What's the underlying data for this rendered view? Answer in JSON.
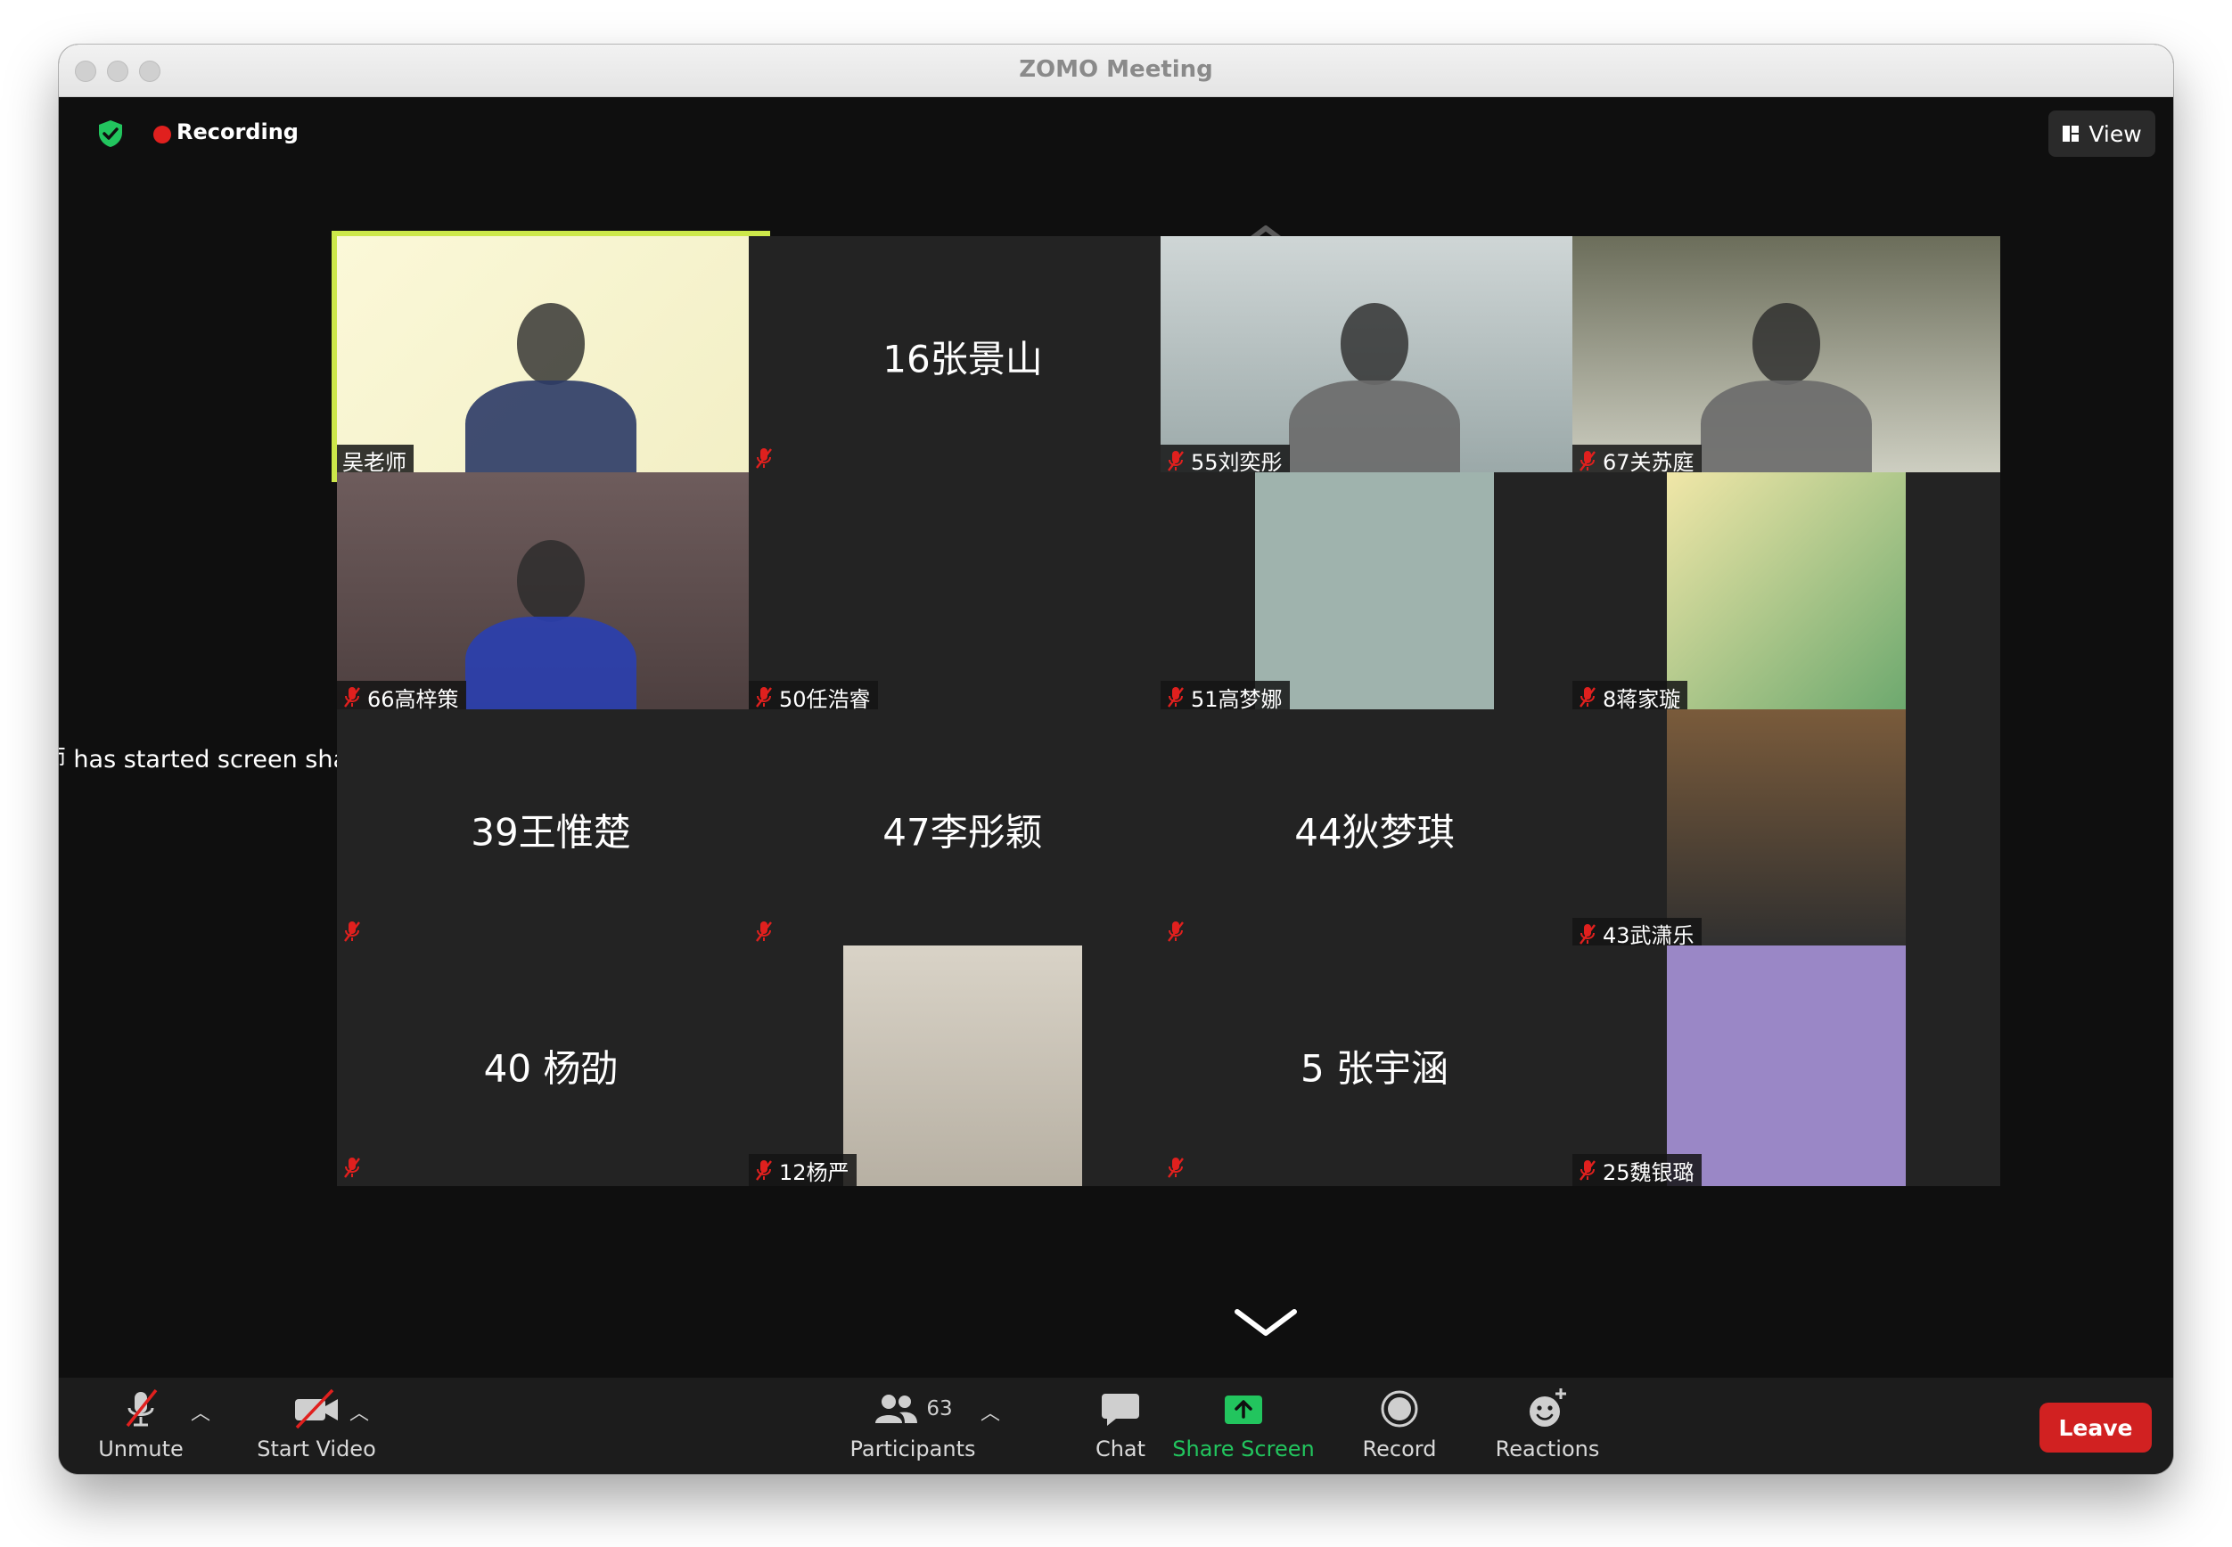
{
  "window": {
    "title": "ZOMO Meeting"
  },
  "topbar": {
    "recording_label": "Recording",
    "view_label": "View"
  },
  "share_notice": "师 has started screen sha",
  "tiles": [
    {
      "name": "吴老师",
      "display": "",
      "kind": "video",
      "active": true
    },
    {
      "name": "",
      "display": "16张景山",
      "kind": "text"
    },
    {
      "name": "55刘奕彤",
      "display": "",
      "kind": "video"
    },
    {
      "name": "67关苏庭",
      "display": "",
      "kind": "video"
    },
    {
      "name": "66高梓策",
      "display": "",
      "kind": "video"
    },
    {
      "name": "50任浩睿",
      "display": "",
      "kind": "blank"
    },
    {
      "name": "51高梦娜",
      "display": "",
      "kind": "avatar"
    },
    {
      "name": "8蒋家璇",
      "display": "",
      "kind": "avatar"
    },
    {
      "name": "",
      "display": "39王惟楚",
      "kind": "text"
    },
    {
      "name": "",
      "display": "47李彤颖",
      "kind": "text"
    },
    {
      "name": "",
      "display": "44狄梦琪",
      "kind": "text"
    },
    {
      "name": "43武潇乐",
      "display": "",
      "kind": "avatar"
    },
    {
      "name": "",
      "display": "40 杨劭",
      "kind": "text"
    },
    {
      "name": "12杨严",
      "display": "",
      "kind": "avatar"
    },
    {
      "name": "",
      "display": "5 张宇涵",
      "kind": "text"
    },
    {
      "name": "25魏银璐",
      "display": "",
      "kind": "avatar"
    }
  ],
  "toolbar": {
    "unmute_label": "Unmute",
    "start_video_label": "Start Video",
    "participants_label": "Participants",
    "participants_count": "63",
    "chat_label": "Chat",
    "share_screen_label": "Share Screen",
    "record_label": "Record",
    "reactions_label": "Reactions",
    "leave_label": "Leave"
  },
  "colors": {
    "active_speaker": "#cde84a",
    "share_green": "#22c55e",
    "leave_red": "#d12121",
    "recording_red": "#e0201e"
  }
}
